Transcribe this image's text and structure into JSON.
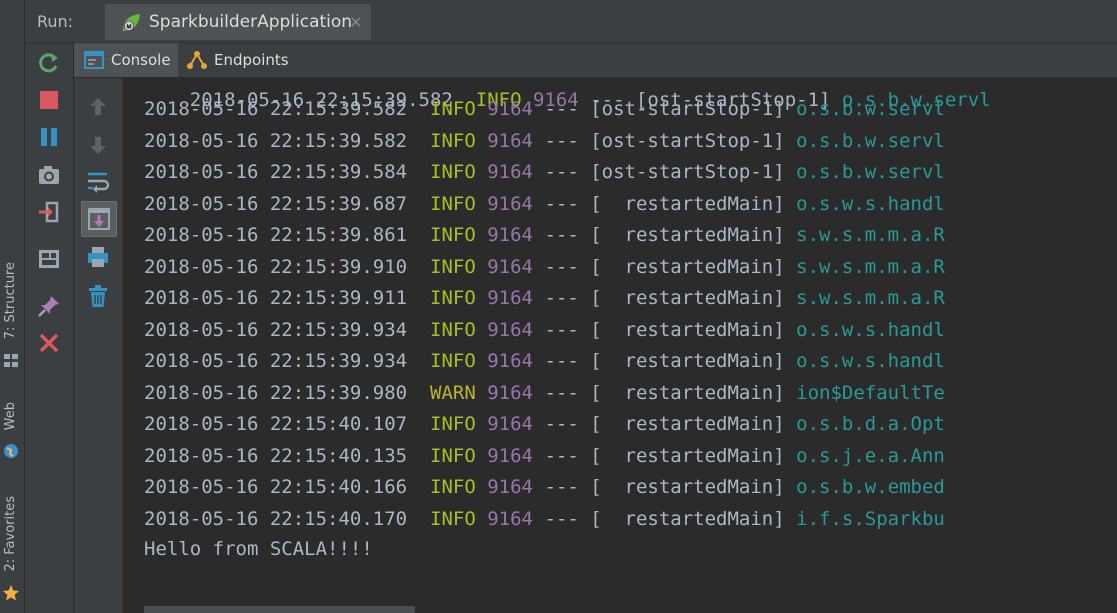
{
  "left_strip": {
    "tabs": [
      {
        "label": "7: Structure",
        "icon": "structure-icon"
      },
      {
        "label": "Web",
        "icon": "web-icon"
      },
      {
        "label": "2: Favorites",
        "icon": "star-icon"
      }
    ]
  },
  "header": {
    "run_label": "Run:",
    "tab_title": "SparkbuilderApplication",
    "close_glyph": "×"
  },
  "subtabs": {
    "console": "Console",
    "endpoints": "Endpoints"
  },
  "actions": [
    "rerun-icon",
    "stop-icon",
    "pause-icon",
    "camera-icon",
    "login-icon",
    "layout-icon",
    "pin-icon",
    "close-red-icon"
  ],
  "tools": [
    "up-arrow-icon",
    "down-arrow-icon",
    "wrap-icon",
    "scroll-to-end-icon",
    "print-icon",
    "trash-icon"
  ],
  "log": {
    "partial_top": {
      "ts": "2018-05-16 22:15:39.582",
      "level": "INFO",
      "pid": "9164",
      "sep": "---",
      "thread": "[ost-startStop-1]",
      "logger": "o.s.b.w.servl"
    },
    "lines": [
      {
        "ts": "2018-05-16 22:15:39.582",
        "level": "INFO",
        "pid": "9164",
        "sep": "---",
        "thread": "[ost-startStop-1]",
        "logger": "o.s.b.w.servl"
      },
      {
        "ts": "2018-05-16 22:15:39.582",
        "level": "INFO",
        "pid": "9164",
        "sep": "---",
        "thread": "[ost-startStop-1]",
        "logger": "o.s.b.w.servl"
      },
      {
        "ts": "2018-05-16 22:15:39.584",
        "level": "INFO",
        "pid": "9164",
        "sep": "---",
        "thread": "[ost-startStop-1]",
        "logger": "o.s.b.w.servl"
      },
      {
        "ts": "2018-05-16 22:15:39.687",
        "level": "INFO",
        "pid": "9164",
        "sep": "---",
        "thread": "[  restartedMain]",
        "logger": "o.s.w.s.handl"
      },
      {
        "ts": "2018-05-16 22:15:39.861",
        "level": "INFO",
        "pid": "9164",
        "sep": "---",
        "thread": "[  restartedMain]",
        "logger": "s.w.s.m.m.a.R"
      },
      {
        "ts": "2018-05-16 22:15:39.910",
        "level": "INFO",
        "pid": "9164",
        "sep": "---",
        "thread": "[  restartedMain]",
        "logger": "s.w.s.m.m.a.R"
      },
      {
        "ts": "2018-05-16 22:15:39.911",
        "level": "INFO",
        "pid": "9164",
        "sep": "---",
        "thread": "[  restartedMain]",
        "logger": "s.w.s.m.m.a.R"
      },
      {
        "ts": "2018-05-16 22:15:39.934",
        "level": "INFO",
        "pid": "9164",
        "sep": "---",
        "thread": "[  restartedMain]",
        "logger": "o.s.w.s.handl"
      },
      {
        "ts": "2018-05-16 22:15:39.934",
        "level": "INFO",
        "pid": "9164",
        "sep": "---",
        "thread": "[  restartedMain]",
        "logger": "o.s.w.s.handl"
      },
      {
        "ts": "2018-05-16 22:15:39.980",
        "level": "WARN",
        "pid": "9164",
        "sep": "---",
        "thread": "[  restartedMain]",
        "logger": "ion$DefaultTe"
      },
      {
        "ts": "2018-05-16 22:15:40.107",
        "level": "INFO",
        "pid": "9164",
        "sep": "---",
        "thread": "[  restartedMain]",
        "logger": "o.s.b.d.a.Opt"
      },
      {
        "ts": "2018-05-16 22:15:40.135",
        "level": "INFO",
        "pid": "9164",
        "sep": "---",
        "thread": "[  restartedMain]",
        "logger": "o.s.j.e.a.Ann"
      },
      {
        "ts": "2018-05-16 22:15:40.166",
        "level": "INFO",
        "pid": "9164",
        "sep": "---",
        "thread": "[  restartedMain]",
        "logger": "o.s.b.w.embed"
      },
      {
        "ts": "2018-05-16 22:15:40.170",
        "level": "INFO",
        "pid": "9164",
        "sep": "---",
        "thread": "[  restartedMain]",
        "logger": "i.f.s.Sparkbu"
      }
    ],
    "final_message": "Hello from SCALA!!!!"
  },
  "colors": {
    "info": "#a8c023",
    "warn": "#bbb529",
    "pid": "#9876aa",
    "logger": "#299999",
    "text": "#a9b7c6"
  }
}
